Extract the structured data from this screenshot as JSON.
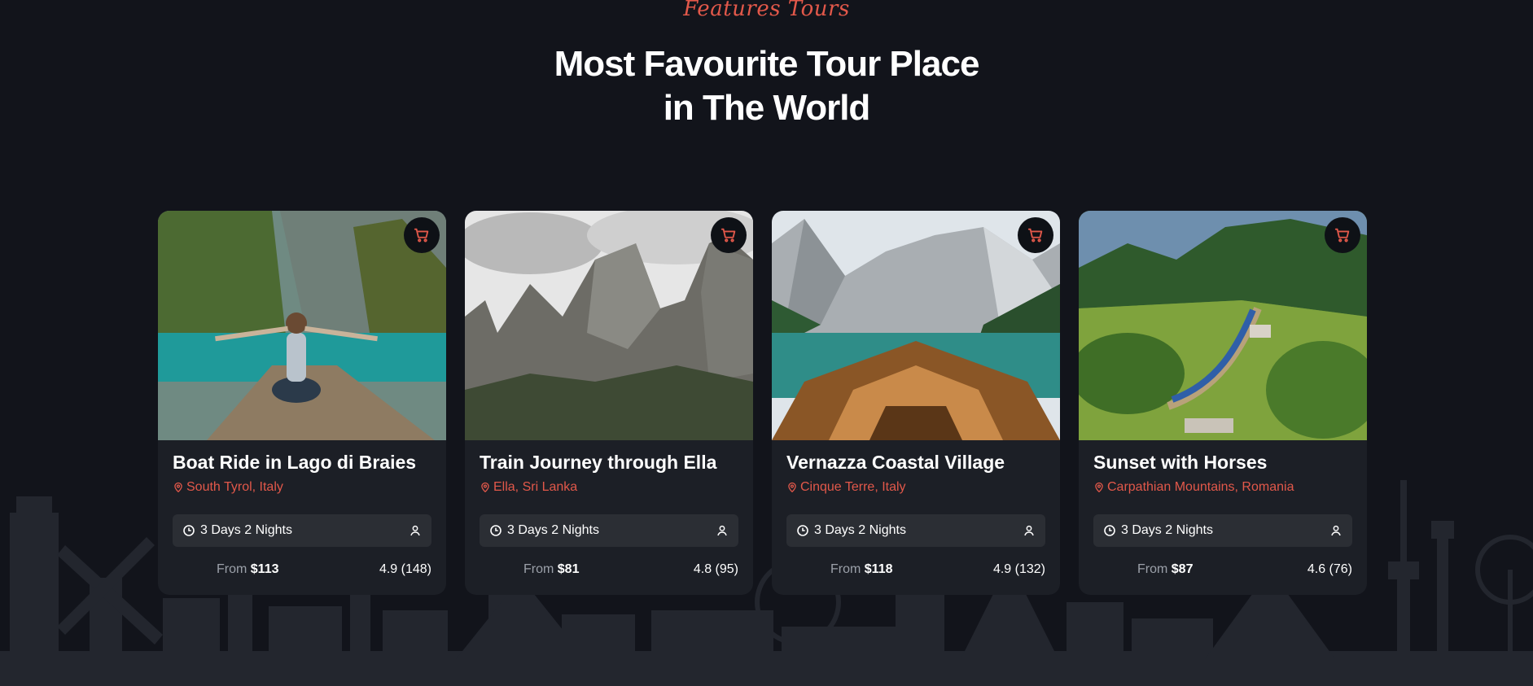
{
  "section": {
    "eyebrow": "Features Tours",
    "title_line1": "Most Favourite Tour Place",
    "title_line2": "in The World"
  },
  "colors": {
    "accent": "#e2584a",
    "background": "#12141b",
    "card": "#1c1f26",
    "pill": "#2b2e34"
  },
  "icons": {
    "cart": "cart-icon",
    "location": "map-pin-icon",
    "clock": "clock-icon",
    "person": "person-icon"
  },
  "tours": [
    {
      "name": "Boat Ride in Lago di Braies",
      "location": "South Tyrol, Italy",
      "duration": "3 Days 2 Nights",
      "price_prefix": "From",
      "price": "$113",
      "rating": "4.9 (148)"
    },
    {
      "name": "Train Journey through Ella",
      "location": "Ella, Sri Lanka",
      "duration": "3 Days 2 Nights",
      "price_prefix": "From",
      "price": "$81",
      "rating": "4.8 (95)"
    },
    {
      "name": "Vernazza Coastal Village",
      "location": "Cinque Terre, Italy",
      "duration": "3 Days 2 Nights",
      "price_prefix": "From",
      "price": "$118",
      "rating": "4.9 (132)"
    },
    {
      "name": "Sunset with Horses",
      "location": "Carpathian Mountains, Romania",
      "duration": "3 Days 2 Nights",
      "price_prefix": "From",
      "price": "$87",
      "rating": "4.6 (76)"
    }
  ]
}
